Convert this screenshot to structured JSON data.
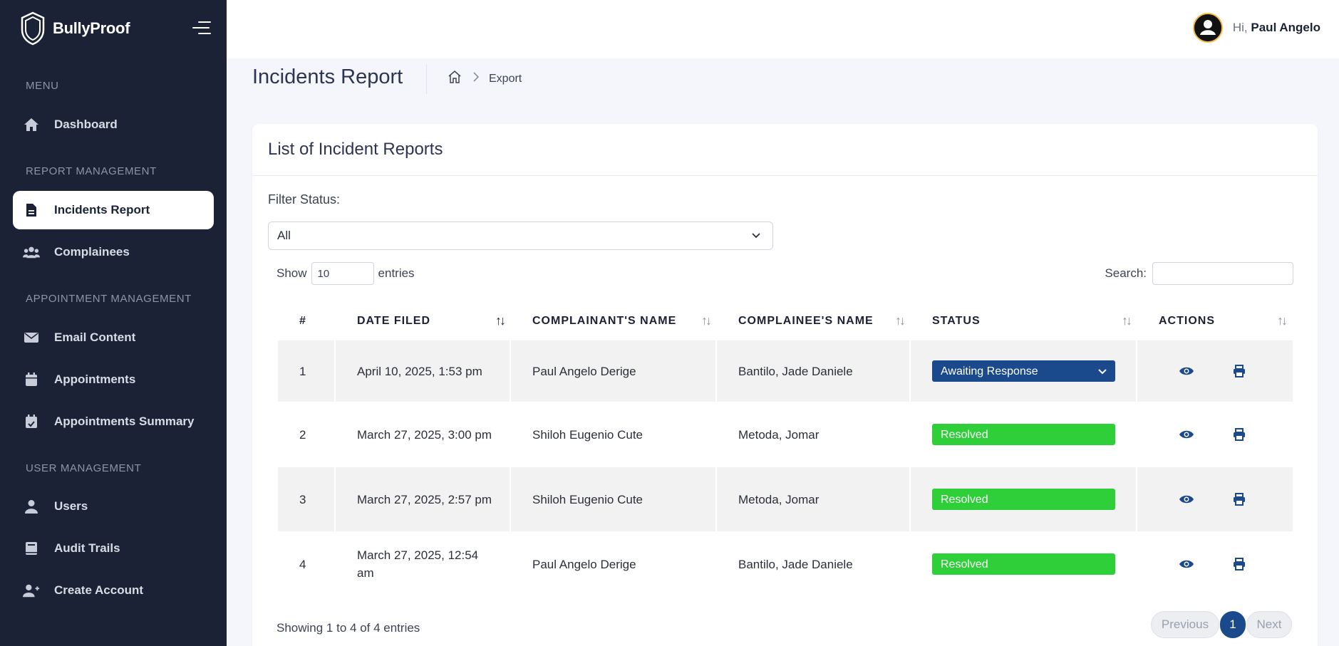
{
  "app": {
    "name": "BullyProof"
  },
  "sidebar": {
    "sections": [
      "MENU",
      "REPORT MANAGEMENT",
      "APPOINTMENT MANAGEMENT",
      "USER MANAGEMENT"
    ],
    "items": [
      {
        "label": "Dashboard",
        "icon": "home-icon"
      },
      {
        "label": "Incidents Report",
        "icon": "document-icon",
        "active": true
      },
      {
        "label": "Complainees",
        "icon": "users-icon"
      },
      {
        "label": "Email Content",
        "icon": "envelope-icon"
      },
      {
        "label": "Appointments",
        "icon": "calendar-icon"
      },
      {
        "label": "Appointments Summary",
        "icon": "calendar-check-icon"
      },
      {
        "label": "Users",
        "icon": "user-icon"
      },
      {
        "label": "Audit Trails",
        "icon": "book-icon"
      },
      {
        "label": "Create Account",
        "icon": "user-plus-icon"
      }
    ]
  },
  "header": {
    "greeting": "Hi,",
    "user_name": "Paul Angelo"
  },
  "page": {
    "title": "Incidents Report",
    "breadcrumb": [
      "home",
      "Export"
    ]
  },
  "card": {
    "title": "List of Incident Reports",
    "filter_label": "Filter Status:",
    "filter_value": "All",
    "show_label": "Show",
    "show_value": "10",
    "entries_label": "entries",
    "search_label": "Search:",
    "search_value": ""
  },
  "table": {
    "columns": [
      "#",
      "DATE FILED",
      "COMPLAINANT'S NAME",
      "COMPLAINEE'S NAME",
      "STATUS",
      "ACTIONS"
    ],
    "rows": [
      {
        "num": "1",
        "date": "April 10, 2025, 1:53 pm",
        "complainant": "Paul Angelo Derige",
        "complainee": "Bantilo, Jade Daniele",
        "status": "Awaiting Response"
      },
      {
        "num": "2",
        "date": "March 27, 2025, 3:00 pm",
        "complainant": "Shiloh Eugenio Cute",
        "complainee": "Metoda, Jomar",
        "status": "Resolved"
      },
      {
        "num": "3",
        "date": "March 27, 2025, 2:57 pm",
        "complainant": "Shiloh Eugenio Cute",
        "complainee": "Metoda, Jomar",
        "status": "Resolved"
      },
      {
        "num": "4",
        "date": "March 27, 2025, 12:54 am",
        "complainant": "Paul Angelo Derige",
        "complainee": "Bantilo, Jade Daniele",
        "status": "Resolved"
      }
    ]
  },
  "footer": {
    "info": "Showing 1 to 4 of 4 entries",
    "prev_label": "Previous",
    "current_page": "1",
    "next_label": "Next"
  },
  "colors": {
    "sidebar_bg": "#1b2236",
    "accent_blue": "#1b4a8c",
    "resolved_green": "#2fcf3a"
  }
}
